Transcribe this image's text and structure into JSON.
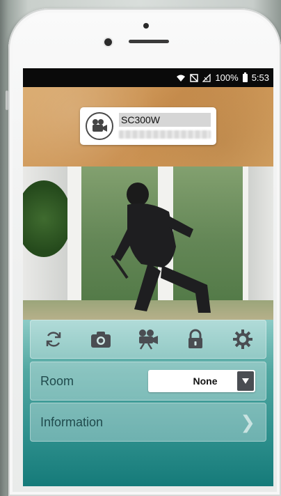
{
  "status_bar": {
    "battery_percent": "100%",
    "time": "5:53"
  },
  "device": {
    "name": "SC300W",
    "icon": "camera-icon"
  },
  "toolbar": {
    "buttons": [
      {
        "icon": "refresh-icon"
      },
      {
        "icon": "snapshot-camera-icon"
      },
      {
        "icon": "record-video-icon"
      },
      {
        "icon": "lock-icon"
      },
      {
        "icon": "settings-gear-icon"
      }
    ]
  },
  "room": {
    "label": "Room",
    "selected": "None"
  },
  "information": {
    "label": "Information",
    "chevron": "❯"
  },
  "colors": {
    "header": "#c98f4f",
    "panel_bg": "#52a8a2",
    "icon": "#4a4d52"
  }
}
